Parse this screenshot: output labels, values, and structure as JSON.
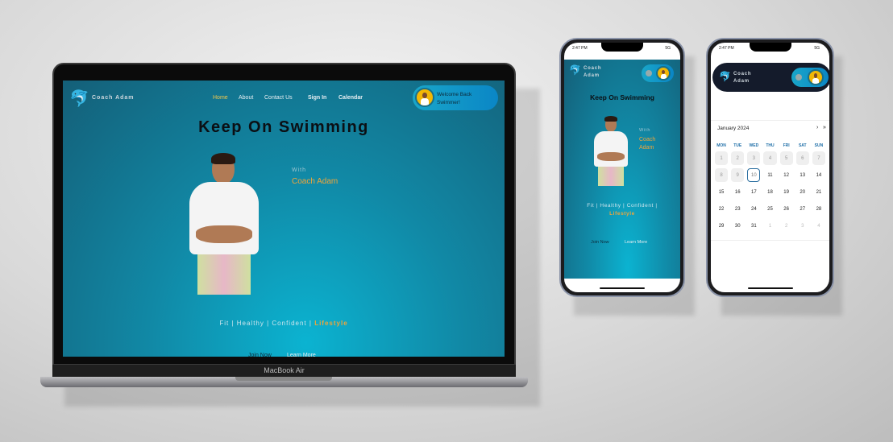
{
  "site": {
    "brand": "Coach Adam",
    "nav": [
      {
        "label": "Home",
        "active": true
      },
      {
        "label": "About"
      },
      {
        "label": "Contact Us"
      },
      {
        "label": "Sign In"
      },
      {
        "label": "Calendar"
      }
    ],
    "welcome": "Welcome Back Swimmer!",
    "title": "Keep On Swimming",
    "with": "With",
    "coach": "Coach Adam",
    "coach_first": "Coach",
    "coach_last": "Adam",
    "tagline": "Fit | Healthy | Confident |",
    "tagline_accent": "Lifestyle",
    "join": "Join Now",
    "learn": "Learn More"
  },
  "device": {
    "laptop_label": "MacBook Air",
    "time": "2:47 PM",
    "signal": "5G"
  },
  "calendar": {
    "month": "January 2024",
    "next": "›",
    "next_year": "»",
    "weekdays": [
      "MON",
      "TUE",
      "WED",
      "THU",
      "FRI",
      "SAT",
      "SUN"
    ],
    "days": [
      1,
      2,
      3,
      4,
      5,
      6,
      7,
      8,
      9,
      10,
      11,
      12,
      13,
      14,
      15,
      16,
      17,
      18,
      19,
      20,
      21,
      22,
      23,
      24,
      25,
      26,
      27,
      28,
      29,
      30,
      31
    ],
    "next_month_days": [
      1,
      2,
      3,
      4
    ],
    "selected": 10
  },
  "colors": {
    "accent": "#f0a53a",
    "active_nav": "#f2c94c",
    "teal": "#1189a6",
    "dark_header": "#141b2b"
  }
}
